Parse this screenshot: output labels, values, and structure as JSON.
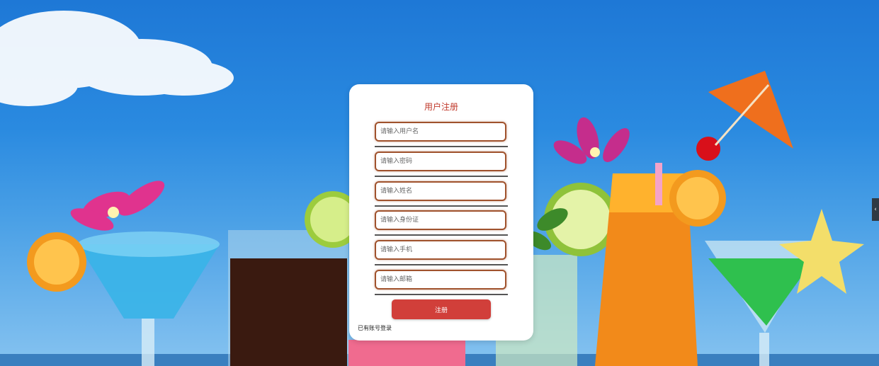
{
  "form": {
    "title": "用户注册",
    "fields": [
      {
        "placeholder": "请输入用户名",
        "value": ""
      },
      {
        "placeholder": "请输入密码",
        "value": ""
      },
      {
        "placeholder": "请输入姓名",
        "value": ""
      },
      {
        "placeholder": "请输入身份证",
        "value": ""
      },
      {
        "placeholder": "请输入手机",
        "value": ""
      },
      {
        "placeholder": "请输入邮箱",
        "value": ""
      }
    ],
    "submit_label": "注册",
    "login_link": "已有账号登录"
  },
  "side_tab": {
    "icon": "chevron-left-icon",
    "glyph": "‹"
  },
  "colors": {
    "title": "#c0392b",
    "button": "#d13f3a",
    "field_border": "#a0522d",
    "sky": "#1e78d6"
  }
}
